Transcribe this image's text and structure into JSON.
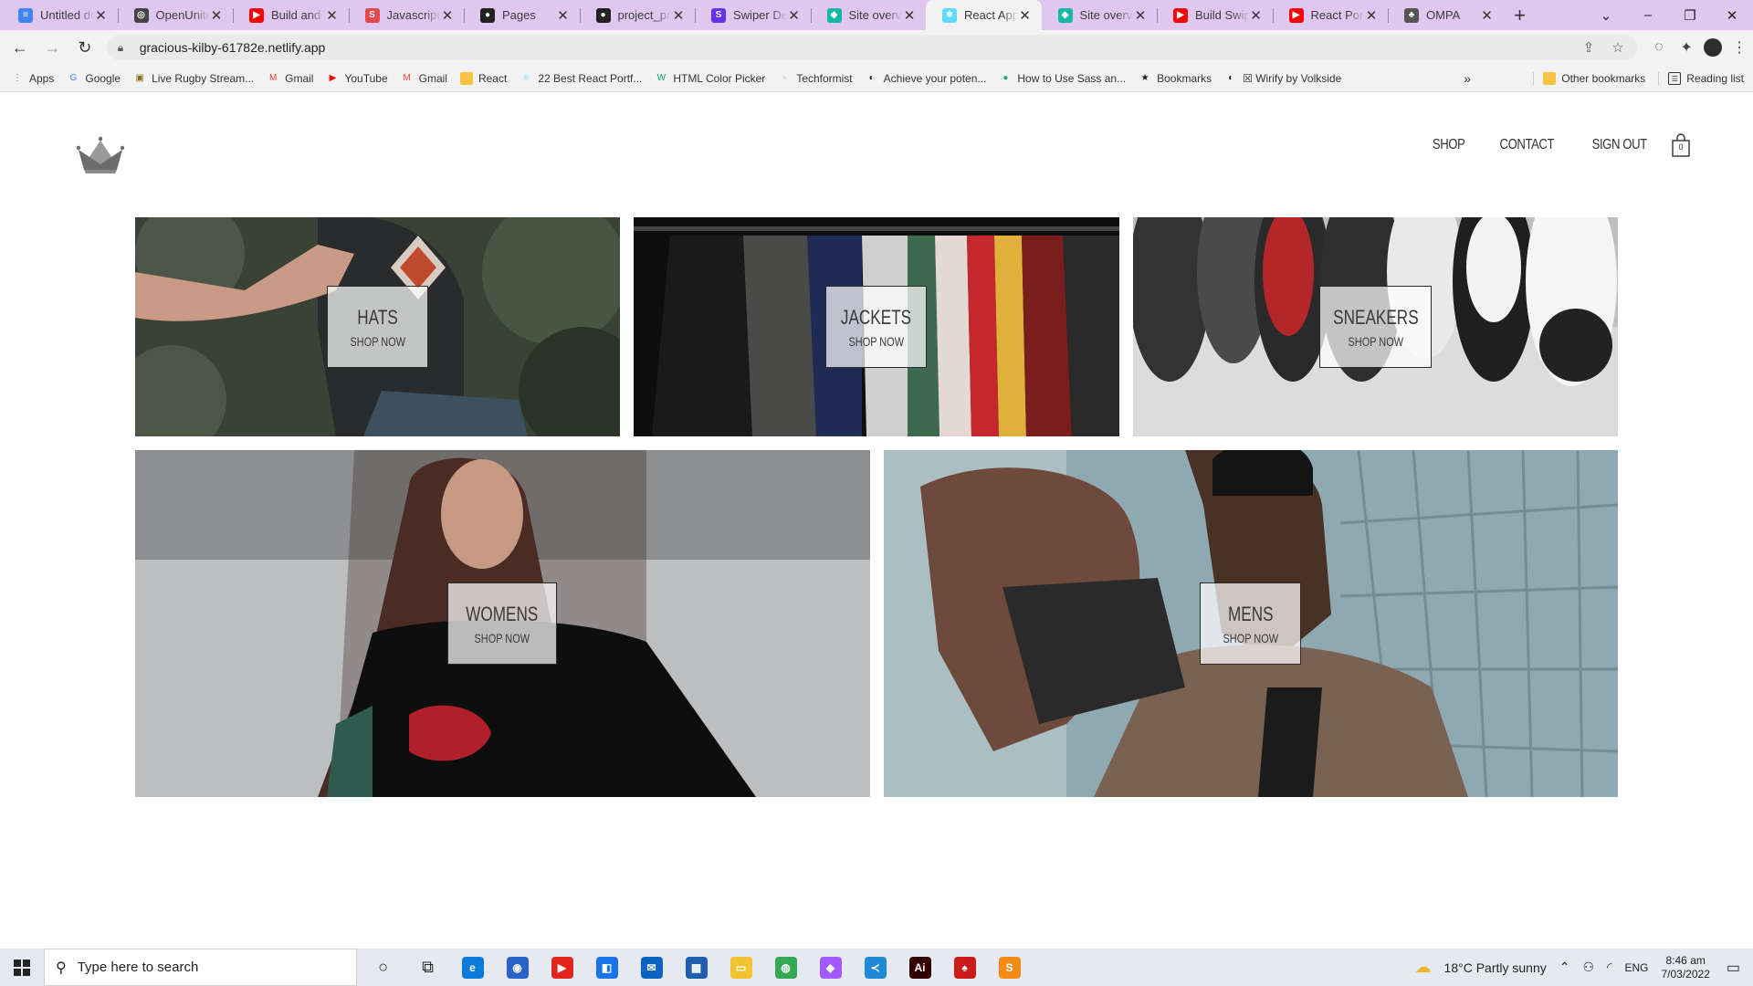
{
  "browser": {
    "tabs": [
      {
        "title": "Untitled do",
        "icon": "docs-icon",
        "color": "#4285f4",
        "glyph": "≡"
      },
      {
        "title": "OpenUnited",
        "icon": "openunited-icon",
        "color": "#444444",
        "glyph": "◎"
      },
      {
        "title": "Build and D",
        "icon": "youtube-icon",
        "color": "#ff0000",
        "glyph": "▶"
      },
      {
        "title": "Javascript M",
        "icon": "scrimba-icon",
        "color": "#e5484d",
        "glyph": "S"
      },
      {
        "title": "Pages",
        "icon": "github-icon",
        "color": "#222222",
        "glyph": "●"
      },
      {
        "title": "project_pro",
        "icon": "github-icon",
        "color": "#222222",
        "glyph": "●"
      },
      {
        "title": "Swiper Dem",
        "icon": "swiper-icon",
        "color": "#6332f6",
        "glyph": "S"
      },
      {
        "title": "Site overvie",
        "icon": "netlify-icon",
        "color": "#14b8a6",
        "glyph": "◆"
      },
      {
        "title": "React App",
        "icon": "react-icon",
        "color": "#61dafb",
        "glyph": "⚛",
        "active": true
      },
      {
        "title": "Site overvie",
        "icon": "netlify-icon",
        "color": "#14b8a6",
        "glyph": "◆"
      },
      {
        "title": "Build Swipe",
        "icon": "youtube-icon",
        "color": "#ff0000",
        "glyph": "▶"
      },
      {
        "title": "React Portfo",
        "icon": "youtube-icon",
        "color": "#ff0000",
        "glyph": "▶"
      },
      {
        "title": "OMPA",
        "icon": "ompa-icon",
        "color": "#555555",
        "glyph": "♣"
      }
    ],
    "url": "gracious-kilby-61782e.netlify.app",
    "bookmarks": [
      {
        "label": "Apps",
        "icon": "apps-grid-icon",
        "color": "#1a73e8",
        "glyph": "⋮"
      },
      {
        "label": "Google",
        "icon": "google-icon",
        "color": "#4285f4",
        "glyph": "G"
      },
      {
        "label": "Live Rugby Stream...",
        "icon": "rugby-icon",
        "color": "#8a6d1e",
        "glyph": "▣"
      },
      {
        "label": "Gmail",
        "icon": "gmail-icon",
        "color": "#ea4335",
        "glyph": "M"
      },
      {
        "label": "YouTube",
        "icon": "youtube-icon",
        "color": "#ff0000",
        "glyph": "▶"
      },
      {
        "label": "Gmail",
        "icon": "gmail-icon",
        "color": "#ea4335",
        "glyph": "M"
      },
      {
        "label": "React",
        "icon": "folder-icon",
        "color": "#f6c344",
        "glyph": ""
      },
      {
        "label": "22 Best React Portf...",
        "icon": "react-icon",
        "color": "#61dafb",
        "glyph": "⚛"
      },
      {
        "label": "HTML Color Picker",
        "icon": "w3schools-icon",
        "color": "#04aa6d",
        "glyph": "W"
      },
      {
        "label": "Techformist",
        "icon": "page-icon",
        "color": "#bbbbbb",
        "glyph": "▫"
      },
      {
        "label": "Achieve your poten...",
        "icon": "globe-icon",
        "color": "#222222",
        "glyph": "◐"
      },
      {
        "label": "How to Use Sass an...",
        "icon": "sass-icon",
        "color": "#2aa876",
        "glyph": "●"
      },
      {
        "label": "Bookmarks",
        "icon": "star-icon",
        "color": "#222222",
        "glyph": "★"
      },
      {
        "label": "☒ Wirify by Volkside",
        "icon": "globe-icon",
        "color": "#222222",
        "glyph": "◐"
      }
    ],
    "other_bookmarks": "Other bookmarks",
    "reading_list": "Reading list"
  },
  "site": {
    "nav": {
      "shop": "SHOP",
      "contact": "CONTACT",
      "signout": "SIGN OUT",
      "cart_count": "0"
    },
    "categories": [
      {
        "title": "HATS",
        "cta": "SHOP NOW"
      },
      {
        "title": "JACKETS",
        "cta": "SHOP NOW"
      },
      {
        "title": "SNEAKERS",
        "cta": "SHOP NOW"
      },
      {
        "title": "WOMENS",
        "cta": "SHOP NOW"
      },
      {
        "title": "MENS",
        "cta": "SHOP NOW"
      }
    ]
  },
  "taskbar": {
    "search_placeholder": "Type here to search",
    "apps": [
      {
        "icon": "cortana-icon",
        "color": "#222222",
        "glyph": "○"
      },
      {
        "icon": "task-view-icon",
        "color": "#222222",
        "glyph": "⧉"
      },
      {
        "icon": "edge-icon",
        "color": "#0c7ad8",
        "glyph": "e"
      },
      {
        "icon": "firefox-icon",
        "color": "#2a62c9",
        "glyph": "◉"
      },
      {
        "icon": "media-player-icon",
        "color": "#e0261c",
        "glyph": "▶"
      },
      {
        "icon": "app-icon",
        "color": "#1a73e8",
        "glyph": "◧"
      },
      {
        "icon": "mail-icon",
        "color": "#0a64c2",
        "glyph": "✉"
      },
      {
        "icon": "photos-icon",
        "color": "#1f5fae",
        "glyph": "▦"
      },
      {
        "icon": "file-explorer-icon",
        "color": "#f1c232",
        "glyph": "▭"
      },
      {
        "icon": "chrome-icon",
        "color": "#34a853",
        "glyph": "◍"
      },
      {
        "icon": "figma-icon",
        "color": "#a259ff",
        "glyph": "◆"
      },
      {
        "icon": "vscode-icon",
        "color": "#1f8ad2",
        "glyph": "≺"
      },
      {
        "icon": "illustrator-icon",
        "color": "#330000",
        "glyph": "Ai"
      },
      {
        "icon": "poker-icon",
        "color": "#cc1b1b",
        "glyph": "♠"
      },
      {
        "icon": "sublime-icon",
        "color": "#f28a18",
        "glyph": "S"
      }
    ],
    "weather": "18°C  Partly sunny",
    "lang": "ENG",
    "time": "8:46 am",
    "date": "7/03/2022"
  }
}
